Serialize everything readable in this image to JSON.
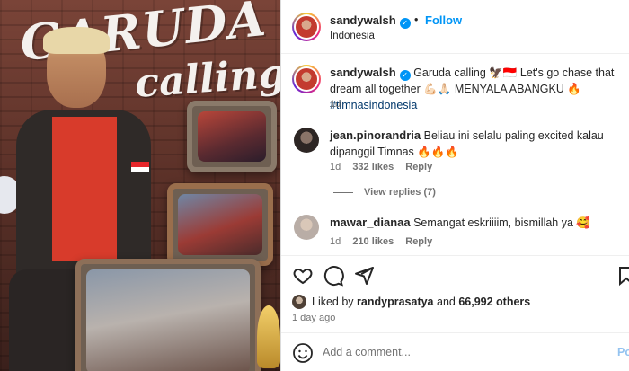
{
  "header": {
    "username": "sandywalsh",
    "follow_label": "Follow",
    "location": "Indonesia",
    "dot": "•"
  },
  "caption": {
    "username": "sandywalsh",
    "text_part1": "Garuda calling 🦅🇮🇩 Let's go chase that dream all together 💪🏻🙏🏻 MENYALA ABANGKU 🔥",
    "hashtag": "#timnasindonesia",
    "time": "1d"
  },
  "comments": [
    {
      "username": "jean.pinorandria",
      "text": "Beliau ini selalu paling excited kalau dipanggil Timnas 🔥🔥🔥",
      "time": "1d",
      "likes": "332 likes",
      "reply_label": "Reply",
      "view_replies": "View replies (7)"
    },
    {
      "username": "mawar_dianaa",
      "text": "Semangat eskriiiim, bismillah ya 🥰",
      "time": "1d",
      "likes": "210 likes",
      "reply_label": "Reply"
    }
  ],
  "likes": {
    "prefix": "Liked by",
    "user": "randyprasatya",
    "conj": "and",
    "others": "66,992 others"
  },
  "date": "1 day ago",
  "add_comment": {
    "placeholder": "Add a comment...",
    "post_label": "Po"
  },
  "photo": {
    "graffiti_line1": "GARUDA",
    "graffiti_line2": "calling"
  },
  "icons": {
    "like": "heart-icon",
    "comment": "comment-icon",
    "share": "share-icon",
    "save": "bookmark-icon",
    "emoji": "emoji-icon",
    "verified": "verified-badge-icon"
  },
  "colors": {
    "accent": "#0095f6",
    "hashtag": "#00376b",
    "muted": "#737373",
    "post_disabled": "#94c3f0"
  }
}
